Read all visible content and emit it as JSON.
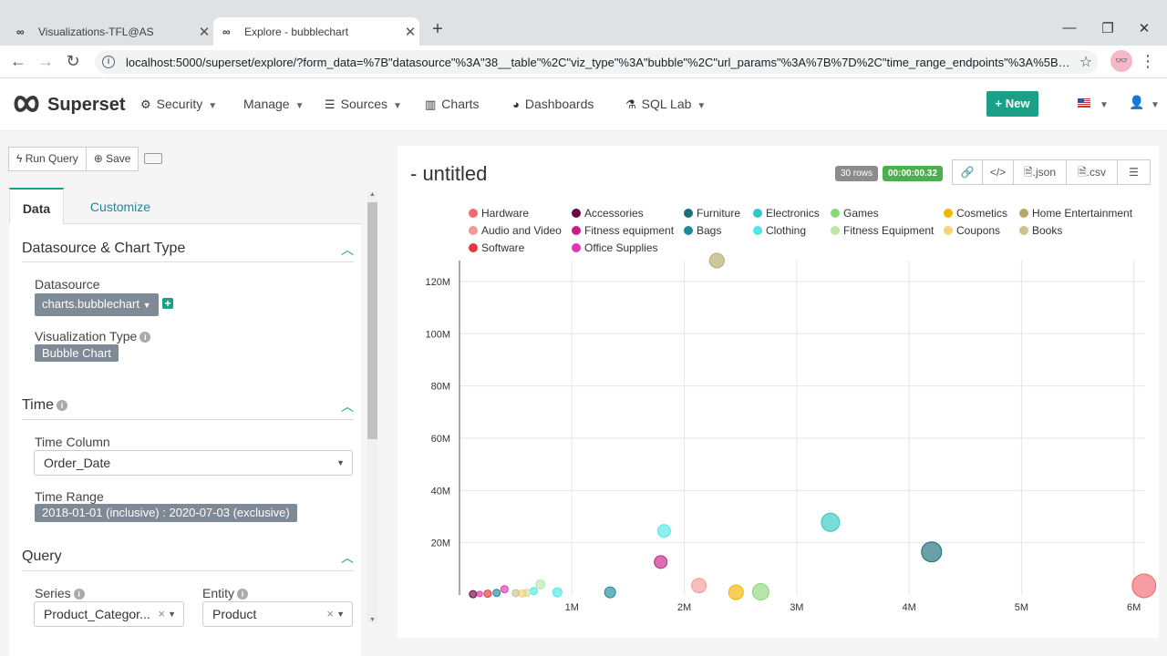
{
  "browser": {
    "tabs": [
      {
        "title": "Visualizations-TFL@AS",
        "active": false
      },
      {
        "title": "Explore - bubblechart",
        "active": true
      }
    ],
    "url": "localhost:5000/superset/explore/?form_data=%7B\"datasource\"%3A\"38__table\"%2C\"viz_type\"%3A\"bubble\"%2C\"url_params\"%3A%7B%7D%2C\"time_range_endpoints\"%3A%5B\"in..."
  },
  "app": {
    "brand": "Superset",
    "nav": [
      {
        "label": "Security",
        "icon": "gears-icon",
        "dropdown": true
      },
      {
        "label": "Manage",
        "icon": "",
        "dropdown": true
      },
      {
        "label": "Sources",
        "icon": "database-icon",
        "dropdown": true
      },
      {
        "label": "Charts",
        "icon": "bar-chart-icon",
        "dropdown": false
      },
      {
        "label": "Dashboards",
        "icon": "dashboard-icon",
        "dropdown": false
      },
      {
        "label": "SQL Lab",
        "icon": "flask-icon",
        "dropdown": true
      }
    ],
    "new_button": "+ New"
  },
  "toolbar": {
    "run_query": "Run Query",
    "save": "Save"
  },
  "panel_tabs": {
    "data": "Data",
    "customize": "Customize"
  },
  "sections": {
    "datasource": {
      "title": "Datasource & Chart Type",
      "datasource_label": "Datasource",
      "datasource_value": "charts.bubblechart",
      "viz_type_label": "Visualization Type",
      "viz_type_value": "Bubble Chart"
    },
    "time": {
      "title": "Time",
      "time_column_label": "Time Column",
      "time_column_value": "Order_Date",
      "time_range_label": "Time Range",
      "time_range_value": "2018-01-01 (inclusive) : 2020-07-03 (exclusive)"
    },
    "query": {
      "title": "Query",
      "series_label": "Series",
      "series_value": "Product_Categor...",
      "entity_label": "Entity",
      "entity_value": "Product"
    }
  },
  "chart_header": {
    "title": "- untitled",
    "rows_badge": "30 rows",
    "time_badge": "00:00:00.32",
    "json_btn": ".json",
    "csv_btn": ".csv",
    "colors": {
      "rows": "#8c8c8c",
      "time": "#4cae4c"
    }
  },
  "chart_data": {
    "type": "scatter",
    "title": "",
    "xlabel": "",
    "ylabel": "",
    "xlim": [
      0,
      6100000
    ],
    "ylim": [
      0,
      128000000
    ],
    "x_ticks": [
      {
        "v": 1000000,
        "label": "1M"
      },
      {
        "v": 2000000,
        "label": "2M"
      },
      {
        "v": 3000000,
        "label": "3M"
      },
      {
        "v": 4000000,
        "label": "4M"
      },
      {
        "v": 5000000,
        "label": "5M"
      },
      {
        "v": 6000000,
        "label": "6M"
      }
    ],
    "y_ticks": [
      {
        "v": 20000000,
        "label": "20M"
      },
      {
        "v": 40000000,
        "label": "40M"
      },
      {
        "v": 60000000,
        "label": "60M"
      },
      {
        "v": 80000000,
        "label": "80M"
      },
      {
        "v": 100000000,
        "label": "100M"
      },
      {
        "v": 120000000,
        "label": "120M"
      }
    ],
    "grid": true,
    "legend_position": "top",
    "series": [
      {
        "name": "Hardware",
        "color": "#f06870",
        "points": [
          {
            "x": 6090000,
            "y": 3500000,
            "size": 13
          }
        ]
      },
      {
        "name": "Accessories",
        "color": "#6b0a3d",
        "points": [
          {
            "x": 120000,
            "y": 300000,
            "size": 4
          }
        ]
      },
      {
        "name": "Furniture",
        "color": "#1a6f7a",
        "points": [
          {
            "x": 4200000,
            "y": 16500000,
            "size": 11
          }
        ]
      },
      {
        "name": "Electronics",
        "color": "#33c7c4",
        "points": [
          {
            "x": 3300000,
            "y": 27800000,
            "size": 10
          }
        ]
      },
      {
        "name": "Games",
        "color": "#8ad87a",
        "points": [
          {
            "x": 2680000,
            "y": 1200000,
            "size": 9
          }
        ]
      },
      {
        "name": "Cosmetics",
        "color": "#f5b400",
        "points": [
          {
            "x": 2460000,
            "y": 1000000,
            "size": 8
          }
        ]
      },
      {
        "name": "Home Entertainment",
        "color": "#b5a96a",
        "points": [
          {
            "x": 2290000,
            "y": 128000000,
            "size": 8
          }
        ]
      },
      {
        "name": "Audio and Video",
        "color": "#f29a9a",
        "points": [
          {
            "x": 2130000,
            "y": 3600000,
            "size": 8
          }
        ]
      },
      {
        "name": "Fitness equipment",
        "color": "#c81f87",
        "points": [
          {
            "x": 1790000,
            "y": 12600000,
            "size": 7
          }
        ]
      },
      {
        "name": "Bags",
        "color": "#1f8a9a",
        "points": [
          {
            "x": 1340000,
            "y": 1000000,
            "size": 6
          },
          {
            "x": 330000,
            "y": 800000,
            "size": 4
          }
        ]
      },
      {
        "name": "Clothing",
        "color": "#4ee8e8",
        "points": [
          {
            "x": 1820000,
            "y": 24500000,
            "size": 7
          },
          {
            "x": 870000,
            "y": 1000000,
            "size": 5
          },
          {
            "x": 660000,
            "y": 1500000,
            "size": 4
          }
        ]
      },
      {
        "name": "Fitness Equipment",
        "color": "#b8e8a8",
        "points": [
          {
            "x": 720000,
            "y": 4000000,
            "size": 5
          },
          {
            "x": 600000,
            "y": 800000,
            "size": 4
          }
        ]
      },
      {
        "name": "Coupons",
        "color": "#f7d27a",
        "points": [
          {
            "x": 560000,
            "y": 600000,
            "size": 4
          }
        ]
      },
      {
        "name": "Books",
        "color": "#c8c48a",
        "points": [
          {
            "x": 500000,
            "y": 700000,
            "size": 4
          }
        ]
      },
      {
        "name": "Software",
        "color": "#e8363c",
        "points": [
          {
            "x": 250000,
            "y": 500000,
            "size": 4
          }
        ]
      },
      {
        "name": "Office Supplies",
        "color": "#e536b0",
        "points": [
          {
            "x": 180000,
            "y": 400000,
            "size": 3
          },
          {
            "x": 400000,
            "y": 2200000,
            "size": 4
          }
        ]
      }
    ]
  }
}
